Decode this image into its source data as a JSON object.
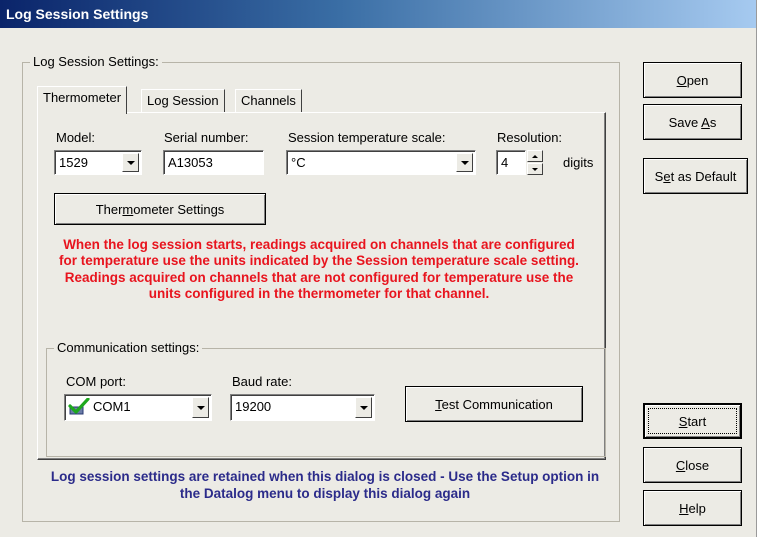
{
  "window": {
    "title": "Log Session Settings"
  },
  "group": {
    "label": "Log Session Settings:"
  },
  "tabs": [
    {
      "label": "Thermometer",
      "active": true
    },
    {
      "label": "Log Session",
      "active": false
    },
    {
      "label": "Channels",
      "active": false
    }
  ],
  "thermometer": {
    "model_label": "Model:",
    "model_value": "1529",
    "serial_label": "Serial number:",
    "serial_value": "A13053",
    "scale_label": "Session temperature scale:",
    "scale_value": "°C",
    "resolution_label": "Resolution:",
    "resolution_value": "4",
    "digits_label": "digits",
    "settings_button": {
      "pre": "Ther",
      "mn": "m",
      "post": "ometer Settings"
    },
    "warning": "When the log session starts, readings acquired on channels that are configured for temperature use the units indicated by the Session temperature scale setting. Readings acquired on channels that are not configured for temperature use the units configured in the thermometer for that channel."
  },
  "communication": {
    "label": "Communication settings:",
    "com_port_label": "COM port:",
    "com_port_value": "COM1",
    "com_port_icon": "green-checkmark-icon",
    "baud_label": "Baud rate:",
    "baud_value": "19200",
    "test_button": {
      "pre": "",
      "mn": "T",
      "post": "est Communication"
    }
  },
  "info": "Log session settings are retained when this dialog is closed - Use the Setup option in the Datalog menu to display this dialog again",
  "side_buttons": {
    "open": {
      "pre": "",
      "mn": "O",
      "post": "pen"
    },
    "save_as": {
      "pre": "Save ",
      "mn": "A",
      "post": "s"
    },
    "set_default": {
      "pre": "S",
      "mn": "e",
      "post": "t as Default"
    },
    "start": {
      "pre": "",
      "mn": "S",
      "post": "tart"
    },
    "close": {
      "pre": "",
      "mn": "C",
      "post": "lose"
    },
    "help": {
      "pre": "",
      "mn": "H",
      "post": "elp"
    }
  },
  "colors": {
    "warning": "#e8141e",
    "info": "#2b2b8a",
    "titlebar_start": "#0a246a",
    "face": "#ecebe5"
  }
}
